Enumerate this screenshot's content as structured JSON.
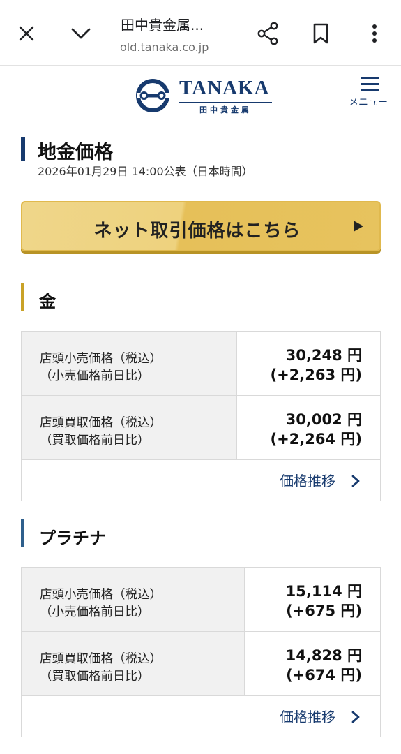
{
  "browser": {
    "title": "田中貴金属...",
    "url": "old.tanaka.co.jp",
    "icons": [
      "close-icon",
      "chevron-down-icon",
      "share-icon",
      "bookmark-icon",
      "more-vert-icon"
    ]
  },
  "site": {
    "brand": "TANAKA",
    "brand_sub": "田中貴金属",
    "menu_label": "メニュー",
    "brand_color": "#173a6e"
  },
  "page": {
    "title": "地金価格",
    "published": "2026年01月29日 14:00公表（日本時間）"
  },
  "net_button": {
    "label": "ネット取引価格はこちら"
  },
  "gold": {
    "title": "金",
    "accent": "#c9a227",
    "rows": [
      {
        "label1": "店頭小売価格（税込）",
        "label2": "（小売価格前日比）",
        "price": "30,248 円",
        "change": "(+2,263 円)"
      },
      {
        "label1": "店頭買取価格（税込）",
        "label2": "（買取価格前日比）",
        "price": "30,002 円",
        "change": "(+2,264 円)"
      }
    ],
    "trend_link": "価格推移"
  },
  "platinum": {
    "title": "プラチナ",
    "accent": "#2e5f8c",
    "rows": [
      {
        "label1": "店頭小売価格（税込）",
        "label2": "（小売価格前日比）",
        "price": "15,114 円",
        "change": "(+675 円)"
      },
      {
        "label1": "店頭買取価格（税込）",
        "label2": "（買取価格前日比）",
        "price": "14,828 円",
        "change": "(+674 円)"
      }
    ],
    "trend_link": "価格推移"
  }
}
